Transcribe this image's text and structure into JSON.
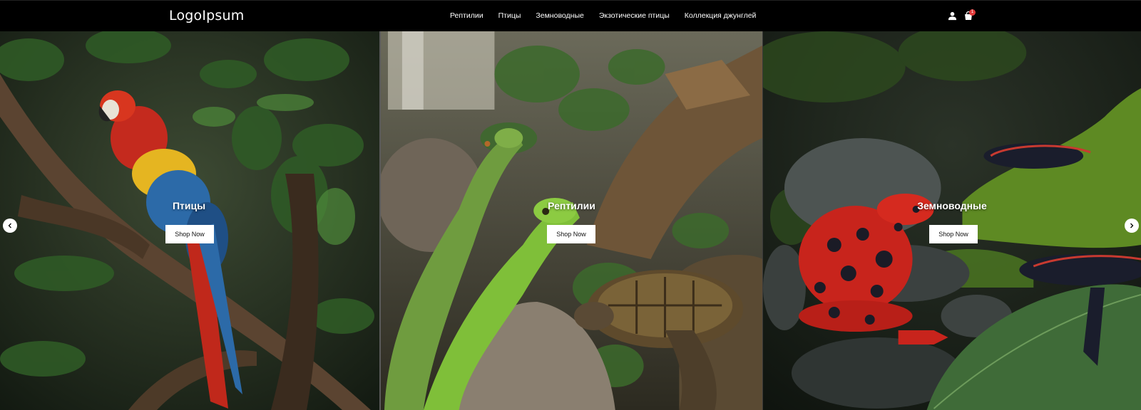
{
  "header": {
    "logo": "LogoIpsum",
    "nav": [
      "Рептилии",
      "Птицы",
      "Земноводные",
      "Экзотические птицы",
      "Коллекция джунглей"
    ],
    "cart_count": "1"
  },
  "panels": [
    {
      "title": "Птицы",
      "button": "Shop Now"
    },
    {
      "title": "Рептилии",
      "button": "Shop Now"
    },
    {
      "title": "Земноводные",
      "button": "Shop Now"
    }
  ],
  "icons": {
    "user": "user-icon",
    "cart": "shopping-bag-icon",
    "prev": "chevron-left-icon",
    "next": "chevron-right-icon"
  }
}
